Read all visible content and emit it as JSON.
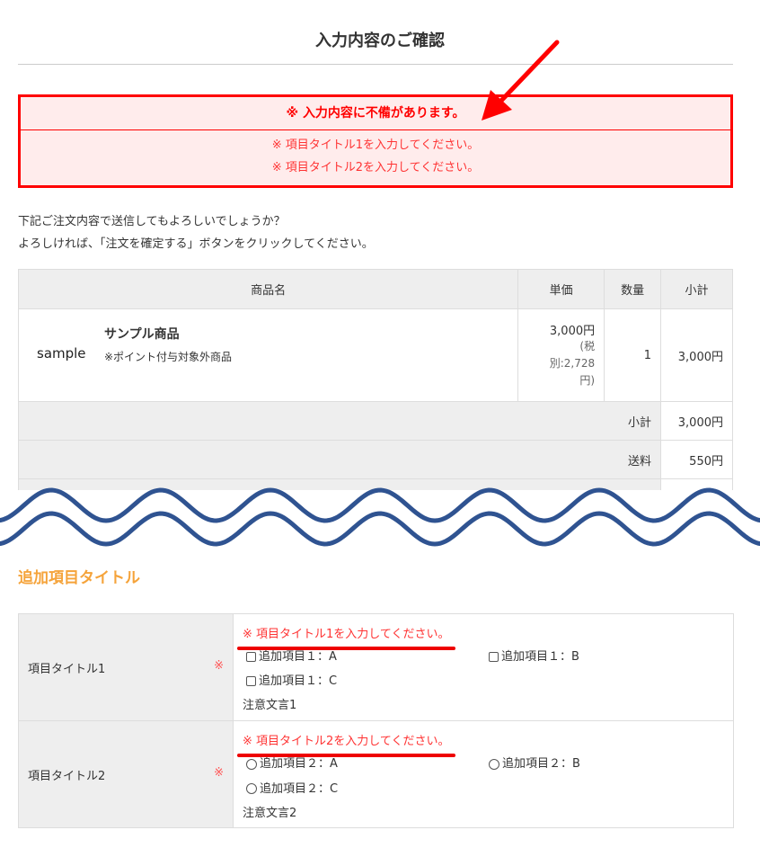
{
  "page_title": "入力内容のご確認",
  "error_box": {
    "heading": "※ 入力内容に不備があります。",
    "messages": [
      "※ 項目タイトル1を入力してください。",
      "※ 項目タイトル2を入力してください。"
    ]
  },
  "intro": [
    "下記ご注文内容で送信してもよろしいでしょうか？",
    "よろしければ、「注文を確定する」ボタンをクリックしてください。"
  ],
  "cart": {
    "headers": {
      "name": "商品名",
      "price": "単価",
      "qty": "数量",
      "subtotal": "小計"
    },
    "item": {
      "image_alt": "sample",
      "name": "サンプル商品",
      "note": "※ポイント付与対象外商品",
      "price": "3,000円",
      "price_ex": "(税別:2,728円)",
      "qty": "1",
      "subtotal": "3,000円"
    },
    "totals": [
      {
        "label": "小計",
        "value": "3,000円"
      },
      {
        "label": "送料",
        "value": "550円"
      }
    ]
  },
  "section_title": "追加項目タイトル",
  "form": [
    {
      "label": "項目タイトル1",
      "required": "※",
      "error": "※ 項目タイトル1を入力してください。",
      "options": [
        "追加項目１：A",
        "追加項目１：B",
        "追加項目１：C"
      ],
      "note": "注意文言1",
      "type": "checkbox"
    },
    {
      "label": "項目タイトル2",
      "required": "※",
      "error": "※ 項目タイトル2を入力してください。",
      "options": [
        "追加項目２：A",
        "追加項目２：B",
        "追加項目２：C"
      ],
      "note": "注意文言2",
      "type": "radio"
    }
  ],
  "colors": {
    "error": "#ff0000",
    "accent": "#f5a33a",
    "wave": "#2f5391"
  }
}
